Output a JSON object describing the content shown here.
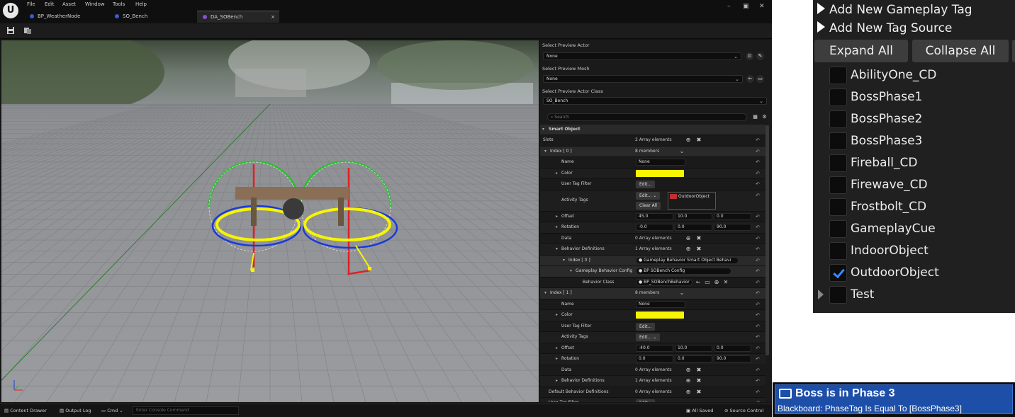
{
  "menu": [
    "File",
    "Edit",
    "Asset",
    "Window",
    "Tools",
    "Help"
  ],
  "tabs": [
    {
      "label": "BP_WeatherNode",
      "color": "#3b5bd6"
    },
    {
      "label": "SO_Bench",
      "color": "#3b5bd6"
    },
    {
      "label": "DA_SOBench",
      "color": "#8a4fd6",
      "close": "×"
    }
  ],
  "window_buttons": [
    "–",
    "▣",
    "✕"
  ],
  "preview": {
    "actor_label": "Select Preview Actor",
    "actor_value": "None",
    "mesh_label": "Select Preview Mesh",
    "mesh_value": "None",
    "class_label": "Select Preview Actor Class",
    "class_value": "SO_Bench"
  },
  "search_placeholder": "Search",
  "details": {
    "category": "Smart Object",
    "slots_label": "Slots",
    "slots_value": "2 Array elements",
    "index0": "Index [ 0 ]",
    "index0_members": "8 members",
    "name_label": "Name",
    "name0": "None",
    "color_label": "Color",
    "user_tag_filter": "User Tag Filter",
    "edit": "Edit...",
    "activity_tags": "Activity Tags",
    "clear_all": "Clear All",
    "tag_chip": "OutdoorObject",
    "offset_label": "Offset",
    "offset0": [
      "45.0",
      "10.0",
      "0.0"
    ],
    "rotation_label": "Rotation",
    "rotation0": [
      "-0.0",
      "0.0",
      "90.0"
    ],
    "data_label": "Data",
    "data_value": "0 Array elements",
    "behavior_defs": "Behavior Definitions",
    "behavior_defs_value": "1 Array elements",
    "bd_index": "Index [ 0 ]",
    "bd_value": "Gameplay Behavior Smart Object Behavi",
    "gbc_label": "Gameplay Behavior Config",
    "gbc_value": "BP SOBench Config",
    "bclass_label": "Behavior Class",
    "bclass_value": "BP_SOBenchBehavior",
    "index1": "Index [ 1 ]",
    "index1_members": "8 members",
    "name1": "None",
    "offset1": [
      "-40.0",
      "10.0",
      "0.0"
    ],
    "rotation1": [
      "0.0",
      "0.0",
      "90.0"
    ],
    "default_bd": "Default Behavior Definitions",
    "default_bd_value": "0 Array elements",
    "user_tag_filter2": "User Tag Filter"
  },
  "status": {
    "content_drawer": "Content Drawer",
    "output_log": "Output Log",
    "cmd": "Cmd",
    "console_placeholder": "Enter Console Command",
    "saved": "All Saved",
    "source_control": "Source Control"
  },
  "tag_panel": {
    "add_tag": "Add New Gameplay Tag",
    "add_source": "Add New Tag Source",
    "expand_all": "Expand All",
    "collapse_all": "Collapse All",
    "tags": [
      {
        "name": "AbilityOne_CD",
        "checked": false
      },
      {
        "name": "BossPhase1",
        "checked": false
      },
      {
        "name": "BossPhase2",
        "checked": false
      },
      {
        "name": "BossPhase3",
        "checked": false
      },
      {
        "name": "Fireball_CD",
        "checked": false
      },
      {
        "name": "Firewave_CD",
        "checked": false
      },
      {
        "name": "Frostbolt_CD",
        "checked": false
      },
      {
        "name": "GameplayCue",
        "checked": false
      },
      {
        "name": "IndoorObject",
        "checked": false
      },
      {
        "name": "OutdoorObject",
        "checked": true
      },
      {
        "name": "Test",
        "checked": false,
        "expandable": true
      }
    ]
  },
  "decorator": {
    "title": "Boss is in Phase 3",
    "subtitle": "Blackboard: PhaseTag Is Equal To [BossPhase3]",
    "color": "#1d4fa8"
  },
  "colors": {
    "gizmo_yellow": "#f7f500",
    "gizmo_green": "#22c22a",
    "gizmo_red": "#e02020",
    "gizmo_blue": "#1a3ad8",
    "accent_blue": "#3a8bff"
  }
}
